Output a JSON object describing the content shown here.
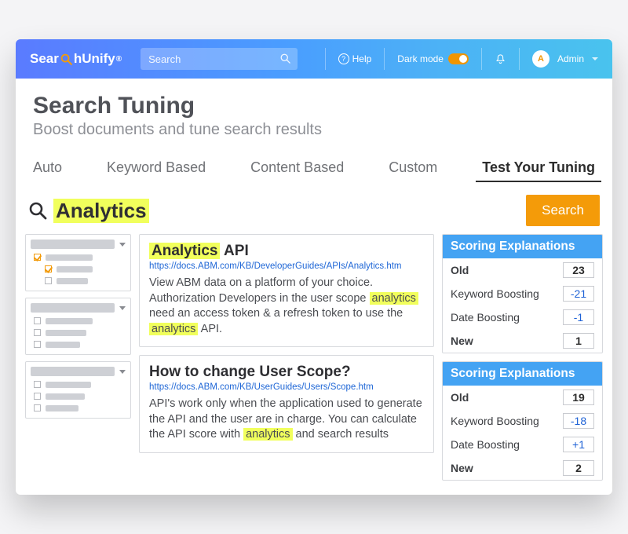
{
  "logo": {
    "brand_left": "Sear",
    "brand_right": "hUnify",
    "registered": "®"
  },
  "topbar": {
    "search_placeholder": "Search",
    "help_label": "Help",
    "dark_mode_label": "Dark mode",
    "admin_label": "Admin",
    "avatar_initial": "A"
  },
  "page": {
    "title": "Search Tuning",
    "subtitle": "Boost documents and tune search results"
  },
  "tabs": [
    "Auto",
    "Keyword Based",
    "Content Based",
    "Custom",
    "Test Your Tuning"
  ],
  "active_tab_index": 4,
  "query": {
    "term": "Analytics",
    "button_label": "Search"
  },
  "results": [
    {
      "title_pre": "",
      "title_hl": "Analytics",
      "title_post": " API",
      "url": "https://docs.ABM.com/KB/DeveloperGuides/APIs/Analytics.htm",
      "para": {
        "a": "View ABM data on a platform of your choice. Authorization Developers in the user scope ",
        "h1": "analytics",
        "b": " need an access token & a refresh token to use the ",
        "h2": "analytics",
        "c": " API."
      }
    },
    {
      "title_pre": "How to change User Scope?",
      "title_hl": "",
      "title_post": "",
      "url": "https://docs.ABM.com/KB/UserGuides/Users/Scope.htm",
      "para": {
        "a": "API's work only when the application used to generate the API and the user are in charge. You can calculate the API score with ",
        "h1": "analytics",
        "b": " and search results",
        "h2": "",
        "c": ""
      }
    }
  ],
  "scoring_header": "Scoring Explanations",
  "scoring_labels": {
    "old": "Old",
    "kw": "Keyword Boosting",
    "date": "Date Boosting",
    "new": "New"
  },
  "scoring": [
    {
      "old": "23",
      "kw": "-21",
      "date": "-1",
      "new": "1"
    },
    {
      "old": "19",
      "kw": "-18",
      "date": "+1",
      "new": "2"
    }
  ]
}
